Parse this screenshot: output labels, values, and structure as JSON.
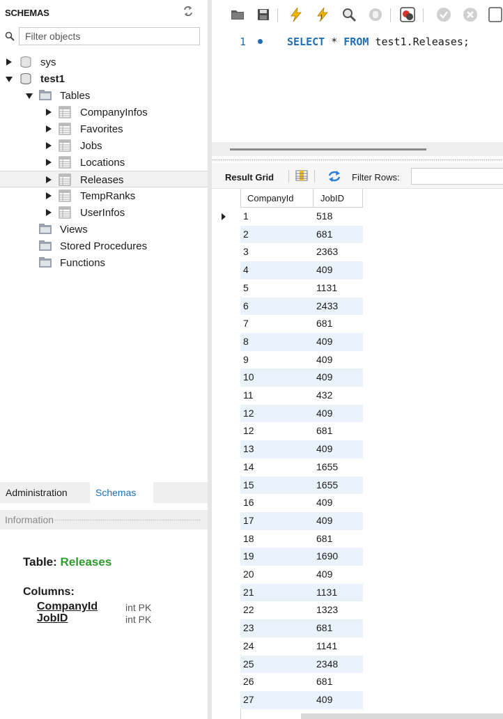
{
  "schemas_panel": {
    "title": "SCHEMAS",
    "filter_placeholder": "Filter objects",
    "tree": [
      {
        "label": "sys",
        "kind": "schema",
        "expanded": false,
        "bold": false
      },
      {
        "label": "test1",
        "kind": "schema",
        "expanded": true,
        "bold": true
      },
      {
        "label": "Tables",
        "kind": "folder",
        "expanded": true
      },
      {
        "label": "CompanyInfos",
        "kind": "table"
      },
      {
        "label": "Favorites",
        "kind": "table"
      },
      {
        "label": "Jobs",
        "kind": "table"
      },
      {
        "label": "Locations",
        "kind": "table"
      },
      {
        "label": "Releases",
        "kind": "table",
        "selected": true
      },
      {
        "label": "TempRanks",
        "kind": "table"
      },
      {
        "label": "UserInfos",
        "kind": "table"
      },
      {
        "label": "Views",
        "kind": "folder"
      },
      {
        "label": "Stored Procedures",
        "kind": "folder"
      },
      {
        "label": "Functions",
        "kind": "folder"
      }
    ]
  },
  "side_tabs": {
    "administration": "Administration",
    "schemas": "Schemas"
  },
  "information": {
    "label": "Information",
    "table_prefix": "Table:",
    "table_name": "Releases",
    "columns_label": "Columns:",
    "columns": [
      {
        "name": "CompanyId",
        "type": "int PK"
      },
      {
        "name": "JobID",
        "type": "int PK"
      }
    ]
  },
  "editor": {
    "line_number": "1",
    "sql_select": "SELECT",
    "sql_star": "*",
    "sql_from": "FROM",
    "sql_target": "test1.Releases;"
  },
  "result_toolbar": {
    "result_grid": "Result Grid",
    "filter_rows": "Filter Rows:"
  },
  "grid": {
    "headers": [
      "CompanyId",
      "JobID"
    ],
    "rows": [
      [
        "1",
        "518"
      ],
      [
        "2",
        "681"
      ],
      [
        "3",
        "2363"
      ],
      [
        "4",
        "409"
      ],
      [
        "5",
        "1131"
      ],
      [
        "6",
        "2433"
      ],
      [
        "7",
        "681"
      ],
      [
        "8",
        "409"
      ],
      [
        "9",
        "409"
      ],
      [
        "10",
        "409"
      ],
      [
        "11",
        "432"
      ],
      [
        "12",
        "409"
      ],
      [
        "12",
        "681"
      ],
      [
        "13",
        "409"
      ],
      [
        "14",
        "1655"
      ],
      [
        "15",
        "1655"
      ],
      [
        "16",
        "409"
      ],
      [
        "17",
        "409"
      ],
      [
        "18",
        "681"
      ],
      [
        "19",
        "1690"
      ],
      [
        "20",
        "409"
      ],
      [
        "21",
        "1131"
      ],
      [
        "22",
        "1323"
      ],
      [
        "23",
        "681"
      ],
      [
        "24",
        "1141"
      ],
      [
        "25",
        "2348"
      ],
      [
        "26",
        "681"
      ],
      [
        "27",
        "409"
      ]
    ],
    "current_row_index": 0,
    "alt_row_color": "#eaf3fb"
  }
}
